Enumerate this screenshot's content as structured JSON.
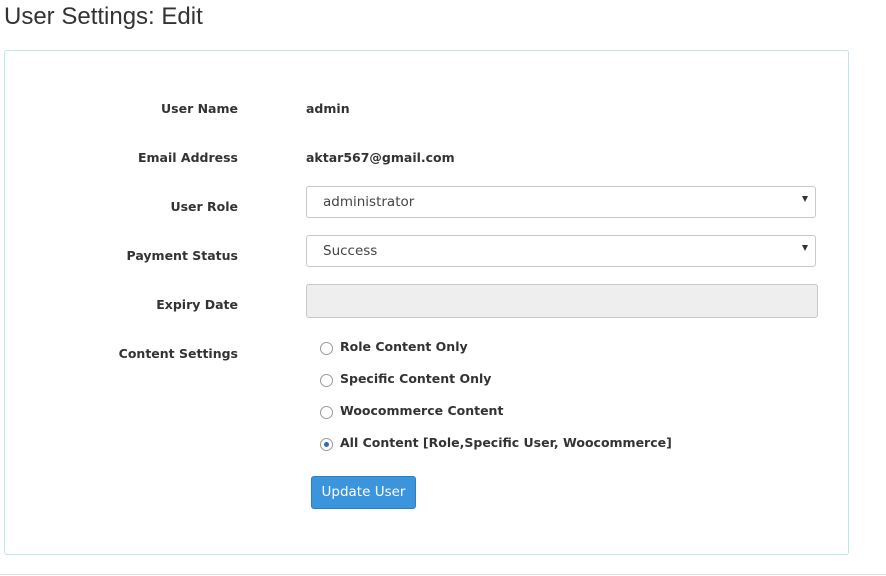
{
  "header": {
    "title": "User Settings: Edit"
  },
  "form": {
    "user_name": {
      "label": "User Name",
      "value": "admin"
    },
    "email": {
      "label": "Email Address",
      "value": "aktar567@gmail.com"
    },
    "user_role": {
      "label": "User Role",
      "selected": "administrator"
    },
    "payment_status": {
      "label": "Payment Status",
      "selected": "Success"
    },
    "expiry_date": {
      "label": "Expiry Date",
      "value": ""
    },
    "content_settings": {
      "label": "Content Settings",
      "options": [
        {
          "label": "Role Content Only",
          "checked": false
        },
        {
          "label": "Specific Content Only",
          "checked": false
        },
        {
          "label": "Woocommerce Content",
          "checked": false
        },
        {
          "label": "All Content [Role,Specific User, Woocommerce]",
          "checked": true
        }
      ]
    },
    "submit_label": "Update User"
  },
  "colors": {
    "primary_button": "#3a95dd",
    "panel_border": "#bfe4e8"
  }
}
